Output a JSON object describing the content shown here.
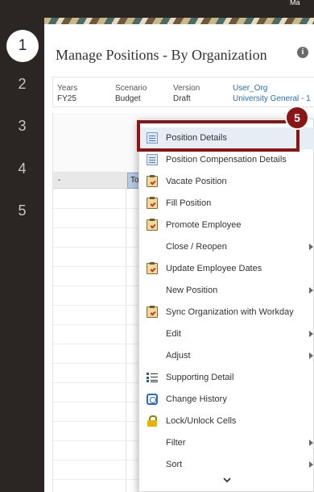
{
  "header": {
    "user_initials": "Ma"
  },
  "rail": {
    "steps": [
      "1",
      "2",
      "3",
      "4",
      "5"
    ],
    "active_step": "1"
  },
  "page": {
    "title": "Manage Positions - By Organization",
    "info_icon_glyph": "i"
  },
  "pov": [
    {
      "label": "Years",
      "value": "FY25",
      "link": false
    },
    {
      "label": "Scenario",
      "value": "Budget",
      "link": false
    },
    {
      "label": "Version",
      "value": "Draft",
      "link": false
    },
    {
      "label": "User_Org",
      "value": "University General - 1",
      "link": true
    }
  ],
  "grid": {
    "first_col_header": "-",
    "total_col_header": "To"
  },
  "menu": {
    "items": [
      {
        "label": "Position Details",
        "icon": "document-grid-icon",
        "submenu": false,
        "highlight": true
      },
      {
        "label": "Position Compensation Details",
        "icon": "document-grid-icon",
        "submenu": false,
        "highlight": false
      },
      {
        "label": "Vacate Position",
        "icon": "clipboard-check-icon",
        "submenu": false,
        "highlight": false
      },
      {
        "label": "Fill Position",
        "icon": "clipboard-check-icon",
        "submenu": false,
        "highlight": false
      },
      {
        "label": "Promote Employee",
        "icon": "clipboard-check-icon",
        "submenu": false,
        "highlight": false
      },
      {
        "label": "Close / Reopen",
        "icon": "",
        "submenu": true,
        "highlight": false
      },
      {
        "label": "Update Employee Dates",
        "icon": "clipboard-check-icon",
        "submenu": false,
        "highlight": false
      },
      {
        "label": "New Position",
        "icon": "",
        "submenu": true,
        "highlight": false
      },
      {
        "label": "Sync Organization with Workday",
        "icon": "clipboard-check-icon",
        "submenu": false,
        "highlight": false
      },
      {
        "label": "Edit",
        "icon": "",
        "submenu": true,
        "highlight": false
      },
      {
        "label": "Adjust",
        "icon": "",
        "submenu": true,
        "highlight": false
      },
      {
        "label": "Supporting Detail",
        "icon": "supporting-detail-icon",
        "submenu": false,
        "highlight": false
      },
      {
        "label": "Change History",
        "icon": "change-history-icon",
        "submenu": false,
        "highlight": false
      },
      {
        "label": "Lock/Unlock Cells",
        "icon": "lock-icon",
        "submenu": false,
        "highlight": false
      },
      {
        "label": "Filter",
        "icon": "",
        "submenu": true,
        "highlight": false
      },
      {
        "label": "Sort",
        "icon": "",
        "submenu": true,
        "highlight": false
      }
    ]
  },
  "callout": {
    "step_number": "5",
    "color": "#8b1514"
  },
  "colors": {
    "rail": "#2b2623",
    "accent_link": "#2a6ebb",
    "highlight": "#e6edf5"
  }
}
